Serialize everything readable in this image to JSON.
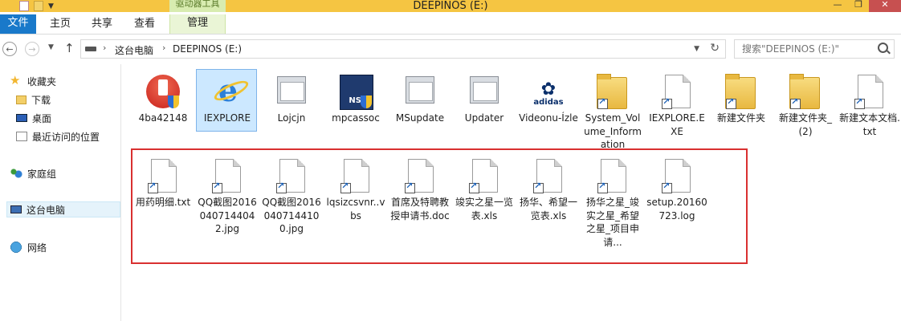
{
  "window": {
    "title": "DEEPINOS (E:)",
    "tool_tab_title": "驱动器工具",
    "buttons": {
      "minimize": "—",
      "maximize": "❐",
      "close": "✕"
    }
  },
  "ribbon": {
    "file": "文件",
    "home": "主页",
    "share": "共享",
    "view": "查看",
    "manage": "管理"
  },
  "address": {
    "crumbs": [
      "这台电脑",
      "DEEPINOS (E:)"
    ],
    "separator": "›",
    "search_placeholder": "搜索\"DEEPINOS (E:)\""
  },
  "nav": {
    "favorites": "收藏夹",
    "downloads": "下载",
    "desktop": "桌面",
    "recent": "最近访问的位置",
    "homegroup": "家庭组",
    "this_pc": "这台电脑",
    "network": "网络"
  },
  "files_row1": [
    {
      "name": "4ba42148",
      "icon": "red-installer-icon"
    },
    {
      "name": "IEXPLORE",
      "icon": "internet-explorer-icon"
    },
    {
      "name": "Lojcjn",
      "icon": "application-icon"
    },
    {
      "name": "mpcassoc",
      "icon": "nsis-installer-icon"
    },
    {
      "name": "MSupdate",
      "icon": "application-icon"
    },
    {
      "name": "Updater",
      "icon": "application-icon"
    },
    {
      "name": "Videonu-Ízle",
      "icon": "adidas-logo-icon"
    },
    {
      "name": "System_Volume_Information",
      "icon": "folder-shortcut-icon"
    },
    {
      "name": "IEXPLORE.EXE",
      "icon": "file-shortcut-icon"
    },
    {
      "name": "新建文件夹",
      "icon": "folder-shortcut-icon"
    },
    {
      "name": "新建文件夹_(2)",
      "icon": "folder-shortcut-icon"
    },
    {
      "name": "新建文本文档.txt",
      "icon": "file-shortcut-icon"
    }
  ],
  "files_row2": [
    {
      "name": "用药明细.txt"
    },
    {
      "name": "QQ截图20160407144042.jpg"
    },
    {
      "name": "QQ截图20160407144100.jpg"
    },
    {
      "name": "lqsizcsvnr..vbs"
    },
    {
      "name": "首席及特聘教授申请书.doc"
    },
    {
      "name": "竣实之星一览表.xls"
    },
    {
      "name": "扬华、希望一览表.xls"
    },
    {
      "name": "扬华之星_竣实之星_希望之星_项目申请..."
    },
    {
      "name": "setup.20160723.log"
    }
  ],
  "colors": {
    "accent": "#1979ca",
    "highlight_box": "#d93030",
    "titlebar": "#f5c542"
  }
}
